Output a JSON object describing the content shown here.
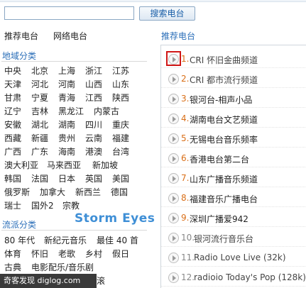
{
  "search": {
    "placeholder": "",
    "value": "",
    "button_label": "搜索电台"
  },
  "tabs": [
    {
      "label": "推荐电台"
    },
    {
      "label": "网络电台"
    }
  ],
  "region": {
    "title": "地域分类",
    "rows": [
      [
        "中央",
        "北京",
        "上海",
        "浙江",
        "江苏"
      ],
      [
        "天津",
        "河北",
        "河南",
        "山西",
        "山东"
      ],
      [
        "甘肃",
        "宁夏",
        "青海",
        "江西",
        "陕西"
      ],
      [
        "辽宁",
        "吉林",
        "黑龙江",
        "内蒙古"
      ],
      [
        "安徽",
        "湖北",
        "湖南",
        "四川",
        "重庆"
      ],
      [
        "西藏",
        "新疆",
        "贵州",
        "云南",
        "福建"
      ],
      [
        "广西",
        "广东",
        "海南",
        "港澳",
        "台湾"
      ],
      [
        "澳大利亚",
        "马来西亚",
        "新加坡"
      ],
      [
        "韩国",
        "法国",
        "日本",
        "英国",
        "美国"
      ],
      [
        "俄罗斯",
        "加拿大",
        "新西兰",
        "德国"
      ],
      [
        "瑞士",
        "国外2",
        "宗教"
      ]
    ]
  },
  "genre": {
    "title": "流派分类",
    "rows": [
      [
        "80 年代",
        "新纪元音乐",
        "最佳 40 首"
      ],
      [
        "体育",
        "怀旧",
        "老歌",
        "乡村",
        "假日"
      ],
      [
        "古典",
        "电影配乐/音乐剧"
      ]
    ],
    "partial_tail": "滚"
  },
  "watermark": "Storm Eyes",
  "recommended": {
    "title": "推荐电台",
    "stations": [
      {
        "num": "1.",
        "name": "CRI 怀旧金曲频道"
      },
      {
        "num": "2.",
        "name": "CRI 都市流行频道"
      },
      {
        "num": "3.",
        "name": "银河台-相声小品"
      },
      {
        "num": "4.",
        "name": "湖南电台文艺频道"
      },
      {
        "num": "5.",
        "name": "无锡电台音乐频率"
      },
      {
        "num": "6.",
        "name": "香港电台第二台"
      },
      {
        "num": "7.",
        "name": "山东广播音乐频道"
      },
      {
        "num": "8.",
        "name": "福建音乐广播电台"
      },
      {
        "num": "9.",
        "name": "深圳广播爱942"
      },
      {
        "num": "10.",
        "name": "银河流行音乐台"
      },
      {
        "num": "11.",
        "name": "Radio Love Live (32k)"
      },
      {
        "num": "12.",
        "name": "radioio Today's Pop (128k)"
      }
    ]
  },
  "footer": {
    "text": "奇客发现 diglog.com"
  },
  "colors": {
    "accent": "#2a6eb8",
    "highlight": "#d01616",
    "number": "#d96f18"
  }
}
